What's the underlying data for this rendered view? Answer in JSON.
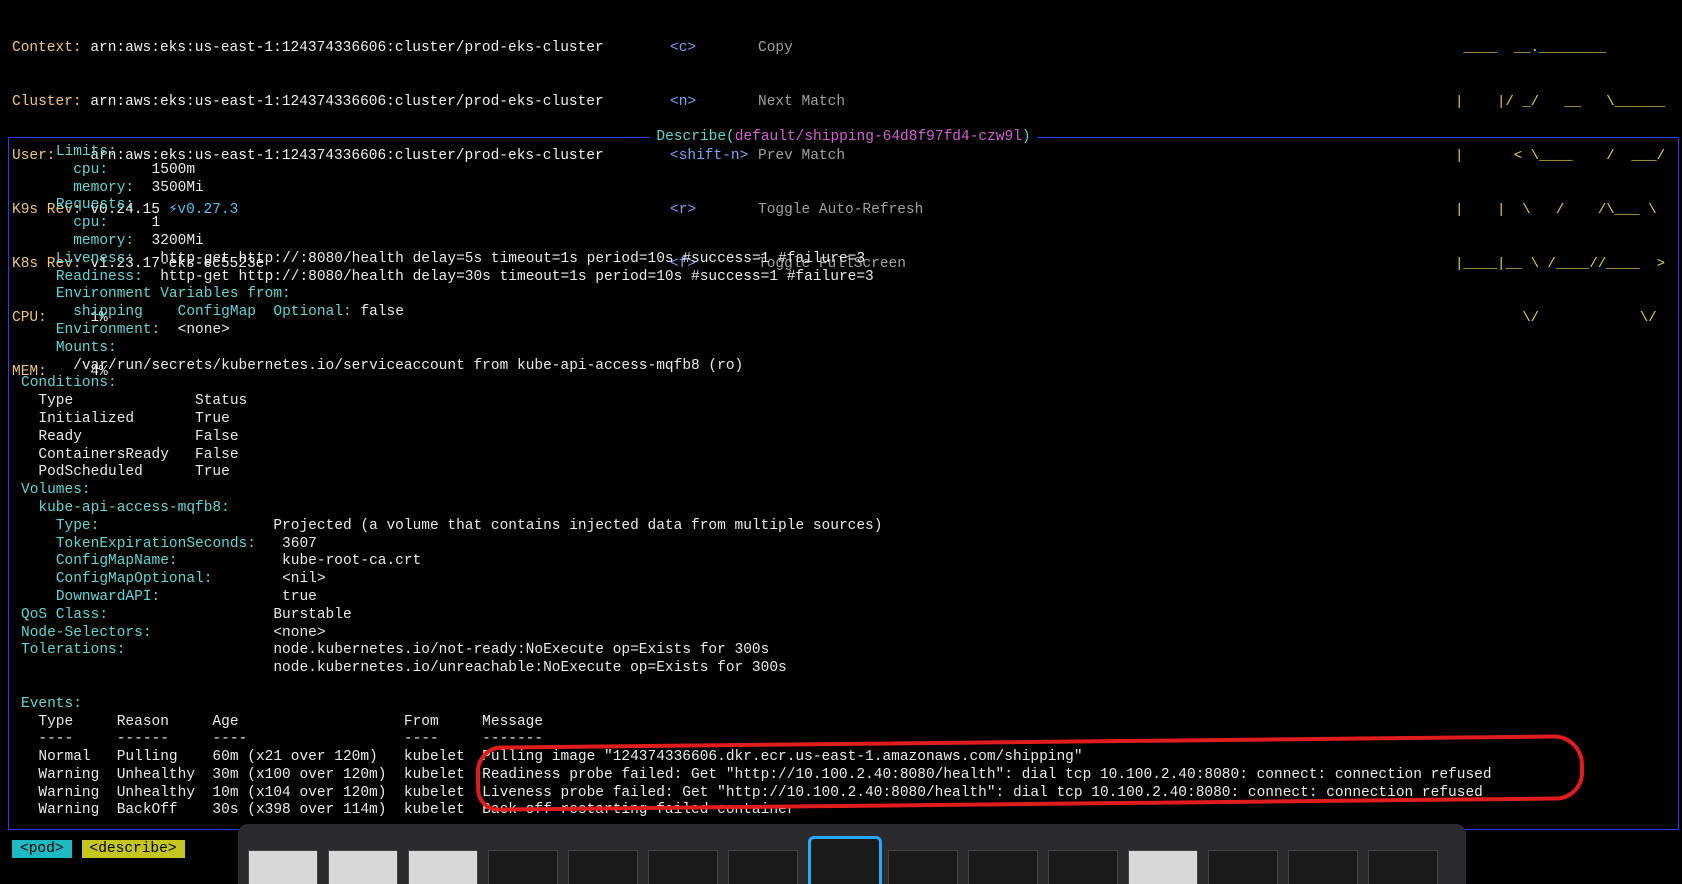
{
  "header": {
    "context_label": "Context:",
    "context_value": "arn:aws:eks:us-east-1:124374336606:cluster/prod-eks-cluster",
    "cluster_label": "Cluster:",
    "cluster_value": "arn:aws:eks:us-east-1:124374336606:cluster/prod-eks-cluster",
    "user_label": "User:",
    "user_value": "arn:aws:eks:us-east-1:124374336606:cluster/prod-eks-cluster",
    "k9s_label": "K9s Rev:",
    "k9s_value": "v0.24.15",
    "k9s_upgrade": "v0.27.3",
    "k8s_label": "K8s Rev:",
    "k8s_value": "v1.23.17-eks-ec5523e",
    "cpu_label": "CPU:",
    "cpu_value": "1%",
    "mem_label": "MEM:",
    "mem_value": "4%"
  },
  "shortcuts": [
    {
      "key": "<c>",
      "label": "Copy"
    },
    {
      "key": "<n>",
      "label": "Next Match"
    },
    {
      "key": "<shift-n>",
      "label": "Prev Match"
    },
    {
      "key": "<r>",
      "label": "Toggle Auto-Refresh"
    },
    {
      "key": "<f>",
      "label": "Toggle FullScreen"
    }
  ],
  "logo": {
    "line1": " ____  __.________       ",
    "line2": "|    |/ _/   __   \\______",
    "line3": "|      < \\____    /  ___/",
    "line4": "|    |  \\   /    /\\___ \\ ",
    "line5": "|____|__ \\ /____//____  >",
    "line6": "        \\/            \\/ "
  },
  "describe": {
    "title_prefix": "Describe(",
    "title_resource": "default/shipping-64d8f97fd4-czw9l",
    "title_suffix": ")"
  },
  "lines": [
    {
      "indent": "    ",
      "k": "Limits:",
      "v": ""
    },
    {
      "indent": "      ",
      "k": "cpu:",
      "v": "     1500m"
    },
    {
      "indent": "      ",
      "k": "memory:",
      "v": "  3500Mi"
    },
    {
      "indent": "    ",
      "k": "Requests:",
      "v": ""
    },
    {
      "indent": "      ",
      "k": "cpu:",
      "v": "     1"
    },
    {
      "indent": "      ",
      "k": "memory:",
      "v": "  3200Mi"
    },
    {
      "indent": "    ",
      "k": "Liveness:",
      "v": "   http-get http://:8080/health delay=5s timeout=1s period=10s #success=1 #failure=3"
    },
    {
      "indent": "    ",
      "k": "Readiness:",
      "v": "  http-get http://:8080/health delay=30s timeout=1s period=10s #success=1 #failure=3"
    },
    {
      "indent": "    ",
      "k": "Environment Variables from:",
      "v": ""
    },
    {
      "indent": "      ",
      "k": "shipping",
      "v": "    ",
      "k2": "ConfigMap  Optional:",
      "v2": " false"
    },
    {
      "indent": "    ",
      "k": "Environment:",
      "v": "  <none>"
    },
    {
      "indent": "    ",
      "k": "Mounts:",
      "v": ""
    },
    {
      "indent": "      ",
      "k": "",
      "v": "/var/run/secrets/kubernetes.io/serviceaccount from kube-api-access-mqfb8 (ro)"
    },
    {
      "indent": "",
      "k": "Conditions:",
      "v": ""
    },
    {
      "indent": "  ",
      "k": "",
      "v": "Type              Status"
    },
    {
      "indent": "  ",
      "k": "",
      "v": "Initialized       True"
    },
    {
      "indent": "  ",
      "k": "",
      "v": "Ready             False"
    },
    {
      "indent": "  ",
      "k": "",
      "v": "ContainersReady   False"
    },
    {
      "indent": "  ",
      "k": "",
      "v": "PodScheduled      True"
    },
    {
      "indent": "",
      "k": "Volumes:",
      "v": ""
    },
    {
      "indent": "  ",
      "k": "kube-api-access-mqfb8:",
      "v": ""
    },
    {
      "indent": "    ",
      "k": "Type:",
      "v": "                    Projected (a volume that contains injected data from multiple sources)"
    },
    {
      "indent": "    ",
      "k": "TokenExpirationSeconds:",
      "v": "   3607"
    },
    {
      "indent": "    ",
      "k": "ConfigMapName:",
      "v": "            kube-root-ca.crt"
    },
    {
      "indent": "    ",
      "k": "ConfigMapOptional:",
      "v": "        <nil>"
    },
    {
      "indent": "    ",
      "k": "DownwardAPI:",
      "v": "              true"
    },
    {
      "indent": "",
      "k": "QoS Class:",
      "v": "                   Burstable"
    },
    {
      "indent": "",
      "k": "Node-Selectors:",
      "v": "              <none>"
    },
    {
      "indent": "",
      "k": "Tolerations:",
      "v": "                 node.kubernetes.io/not-ready:NoExecute op=Exists for 300s"
    },
    {
      "indent": "",
      "k": "",
      "v": "                             node.kubernetes.io/unreachable:NoExecute op=Exists for 300s"
    },
    {
      "indent": "",
      "k": "",
      "v": ""
    },
    {
      "indent": "",
      "k": "Events:",
      "v": ""
    },
    {
      "indent": "  ",
      "k": "",
      "v": "Type     Reason     Age                   From     Message"
    },
    {
      "indent": "  ",
      "k": "",
      "v": "----     ------     ----                  ----     -------"
    },
    {
      "indent": "  ",
      "k": "",
      "v": "Normal   Pulling    60m (x21 over 120m)   kubelet  Pulling image \"124374336606.dkr.ecr.us-east-1.amazonaws.com/shipping\""
    },
    {
      "indent": "  ",
      "k": "",
      "v": "Warning  Unhealthy  30m (x100 over 120m)  kubelet  Readiness probe failed: Get \"http://10.100.2.40:8080/health\": dial tcp 10.100.2.40:8080: connect: connection refused"
    },
    {
      "indent": "  ",
      "k": "",
      "v": "Warning  Unhealthy  10m (x104 over 120m)  kubelet  Liveness probe failed: Get \"http://10.100.2.40:8080/health\": dial tcp 10.100.2.40:8080: connect: connection refused"
    },
    {
      "indent": "  ",
      "k": "",
      "v": "Warning  BackOff    30s (x398 over 114m)  kubelet  Back-off restarting failed container"
    }
  ],
  "crumbs": [
    {
      "label": "<pod>"
    },
    {
      "label": "<describe>"
    }
  ]
}
